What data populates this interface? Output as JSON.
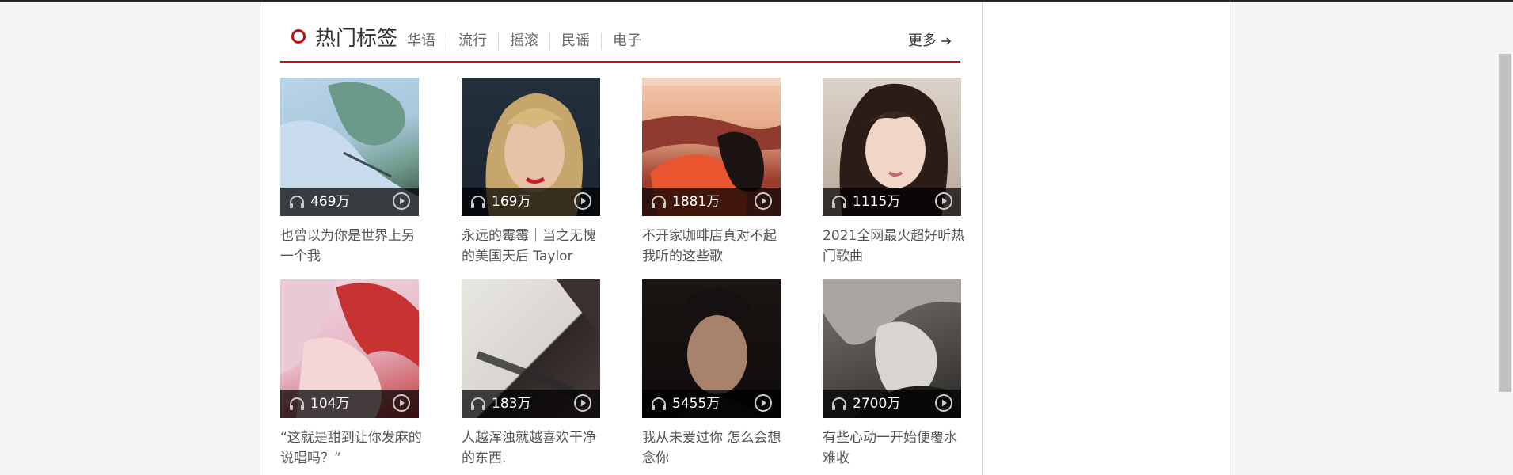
{
  "section": {
    "title": "热门标签",
    "tags": [
      "华语",
      "流行",
      "摇滚",
      "民谣",
      "电子"
    ],
    "more_label": "更多",
    "accent_color": "#c10d0c"
  },
  "playlists": [
    {
      "count": "469万",
      "title": "也曾以为你是世界上另一个我",
      "icon": "headphones-icon"
    },
    {
      "count": "169万",
      "title": "永远的霉霉｜当之无愧的美国天后 Taylor",
      "icon": "headphones-icon"
    },
    {
      "count": "1881万",
      "title": "不开家咖啡店真对不起我听的这些歌",
      "icon": "headphones-icon"
    },
    {
      "count": "1115万",
      "title": "2021全网最火超好听热门歌曲",
      "icon": "headphones-icon"
    },
    {
      "count": "104万",
      "title": "“这就是甜到让你发麻的说唱吗？”",
      "icon": "headphones-icon"
    },
    {
      "count": "183万",
      "title": "人越浑浊就越喜欢干净的东西.",
      "icon": "headphones-icon"
    },
    {
      "count": "5455万",
      "title": "我从未爱过你 怎么会想念你",
      "icon": "headphones-icon"
    },
    {
      "count": "2700万",
      "title": "有些心动一开始便覆水难收",
      "icon": "headphones-icon"
    }
  ]
}
